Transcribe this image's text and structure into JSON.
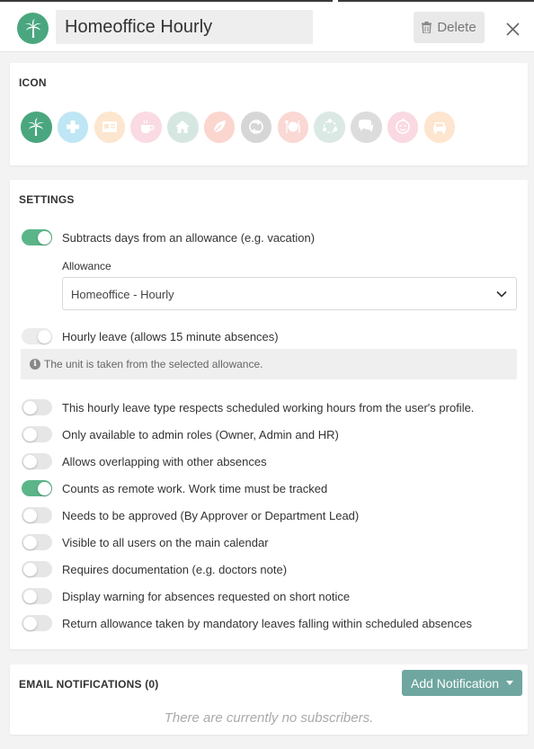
{
  "header": {
    "icon": "palm-tree-icon",
    "title": "Homeoffice Hourly",
    "delete_label": "Delete"
  },
  "icon_section": {
    "title": "ICON",
    "icons": [
      {
        "name": "palm-tree-icon",
        "color": "#4aa67f",
        "selected": true
      },
      {
        "name": "medical-cross-icon",
        "color": "#bfe6f5"
      },
      {
        "name": "id-card-icon",
        "color": "#fde6cf"
      },
      {
        "name": "coffee-cup-icon",
        "color": "#fadbe3"
      },
      {
        "name": "home-icon",
        "color": "#d6e7e2"
      },
      {
        "name": "leaf-icon",
        "color": "#fad6cf"
      },
      {
        "name": "exchange-icon",
        "color": "#d6d6d6"
      },
      {
        "name": "dining-icon",
        "color": "#fad8d3"
      },
      {
        "name": "team-icon",
        "color": "#dbe9e5"
      },
      {
        "name": "chat-bubbles-icon",
        "color": "#dcdcdc"
      },
      {
        "name": "baby-icon",
        "color": "#fad9e2"
      },
      {
        "name": "car-icon",
        "color": "#fde5cf"
      }
    ]
  },
  "settings": {
    "title": "SETTINGS",
    "subtract_label": "Subtracts days from an allowance (e.g. vacation)",
    "allowance_label": "Allowance",
    "allowance_value": "Homeoffice - Hourly",
    "hourly_label": "Hourly leave (allows 15 minute absences)",
    "info_text": "The unit is taken from the selected allowance.",
    "options": [
      {
        "label": "This hourly leave type respects scheduled working hours from the user's profile.",
        "on": false
      },
      {
        "label": "Only available to admin roles (Owner, Admin and HR)",
        "on": false
      },
      {
        "label": "Allows overlapping with other absences",
        "on": false
      },
      {
        "label": "Counts as remote work. Work time must be tracked",
        "on": true
      },
      {
        "label": "Needs to be approved (By Approver or Department Lead)",
        "on": false
      },
      {
        "label": "Visible to all users on the main calendar",
        "on": false
      },
      {
        "label": "Requires documentation (e.g. doctors note)",
        "on": false
      },
      {
        "label": "Display warning for absences requested on short notice",
        "on": false
      },
      {
        "label": "Return allowance taken by mandatory leaves falling within scheduled absences",
        "on": false
      }
    ]
  },
  "notifications": {
    "title": "EMAIL NOTIFICATIONS (0)",
    "add_label": "Add Notification",
    "empty_text": "There are currently no subscribers."
  }
}
